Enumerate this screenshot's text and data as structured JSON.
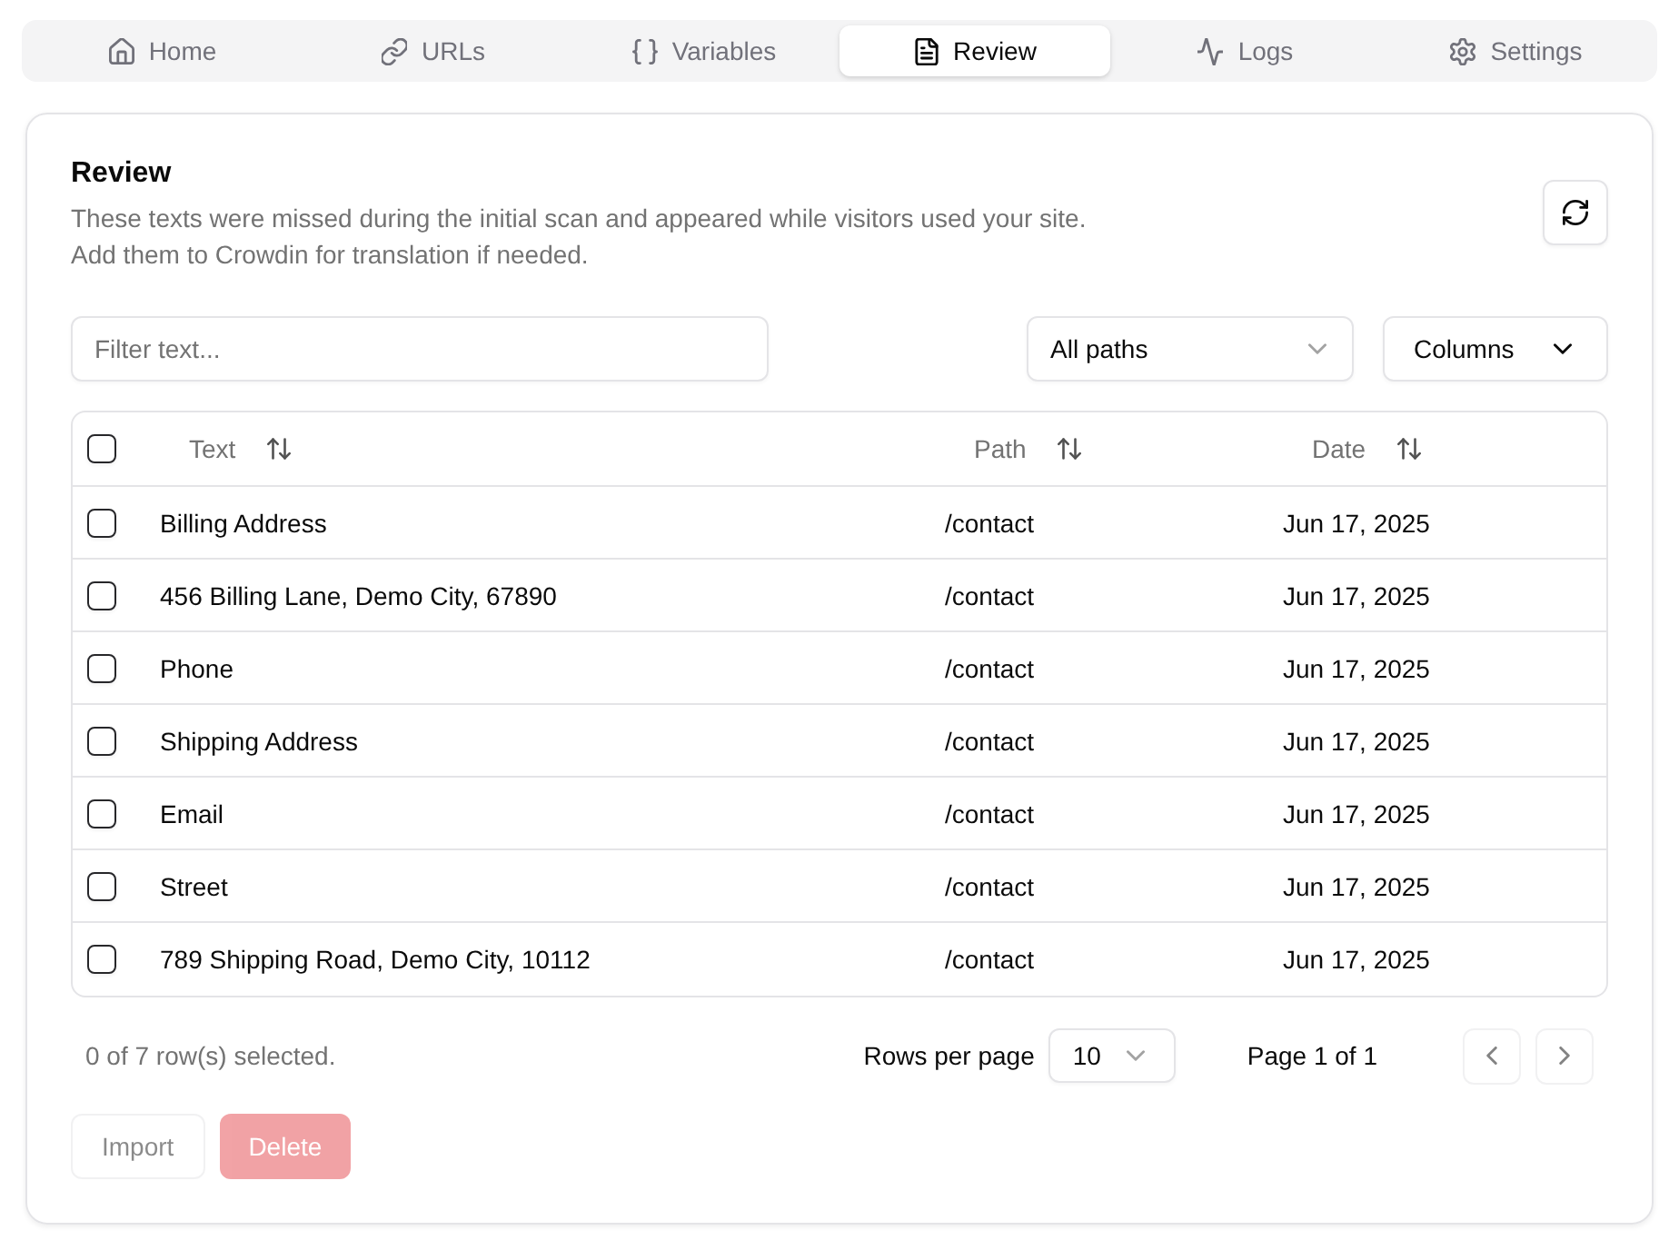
{
  "tabs": [
    {
      "label": "Home",
      "selected": false
    },
    {
      "label": "URLs",
      "selected": false
    },
    {
      "label": "Variables",
      "selected": false
    },
    {
      "label": "Review",
      "selected": true
    },
    {
      "label": "Logs",
      "selected": false
    },
    {
      "label": "Settings",
      "selected": false
    }
  ],
  "panel": {
    "title": "Review",
    "description": [
      "These texts were missed during the initial scan and appeared while visitors used your site.",
      "Add them to Crowdin for translation if needed."
    ]
  },
  "toolbar": {
    "filter": {
      "placeholder": "Filter text..."
    },
    "path_select": {
      "value": "All paths"
    },
    "columns_button": "Columns"
  },
  "table": {
    "select_all_checked": false,
    "columns": [
      {
        "label": "Text"
      },
      {
        "label": "Path"
      },
      {
        "label": "Date"
      }
    ],
    "rows": [
      {
        "text": "Billing Address",
        "path": "/contact",
        "date": "Jun 17, 2025",
        "checked": false
      },
      {
        "text": "456 Billing Lane, Demo City, 67890",
        "path": "/contact",
        "date": "Jun 17, 2025",
        "checked": false
      },
      {
        "text": "Phone",
        "path": "/contact",
        "date": "Jun 17, 2025",
        "checked": false
      },
      {
        "text": "Shipping Address",
        "path": "/contact",
        "date": "Jun 17, 2025",
        "checked": false
      },
      {
        "text": "Email",
        "path": "/contact",
        "date": "Jun 17, 2025",
        "checked": false
      },
      {
        "text": "Street",
        "path": "/contact",
        "date": "Jun 17, 2025",
        "checked": false
      },
      {
        "text": "789 Shipping Road, Demo City, 10112",
        "path": "/contact",
        "date": "Jun 17, 2025",
        "checked": false
      }
    ]
  },
  "footer": {
    "selection": "0 of 7 row(s) selected.",
    "rows_per_page_label": "Rows per page",
    "rows_per_page": "10",
    "page": "Page 1 of 1",
    "previous_disabled": true,
    "next_disabled": true
  },
  "actions": [
    {
      "label": "Import",
      "kind": "outline",
      "disabled": true
    },
    {
      "label": "Delete",
      "kind": "destructive",
      "disabled": true
    }
  ]
}
